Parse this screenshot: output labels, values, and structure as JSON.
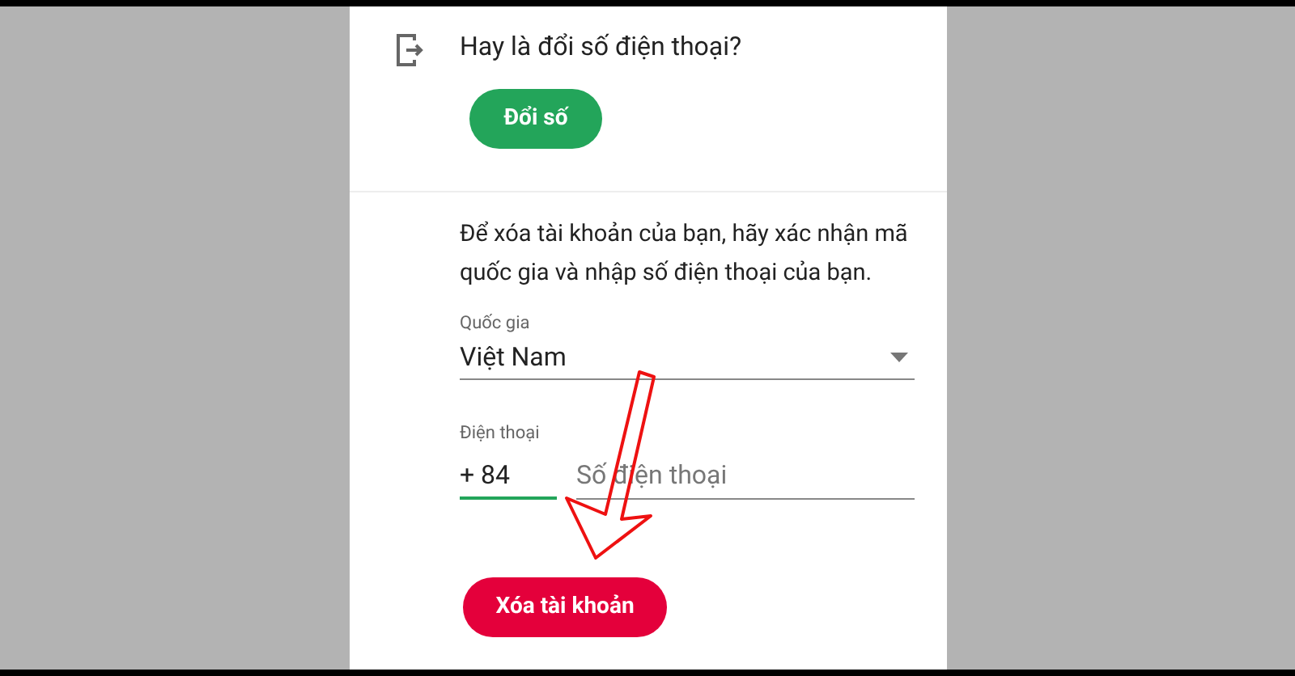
{
  "change_number": {
    "title": "Hay là đổi số điện thoại?",
    "button": "Đổi số"
  },
  "delete_form": {
    "description": "Để xóa tài khoản của bạn, hãy xác nhận mã quốc gia và nhập số điện thoại của bạn.",
    "country": {
      "label": "Quốc gia",
      "value": "Việt Nam"
    },
    "phone": {
      "label": "Điện thoại",
      "prefix": "+ 84",
      "prefix_focused": true,
      "placeholder": "Số điện thoại"
    },
    "button": "Xóa tài khoản"
  }
}
